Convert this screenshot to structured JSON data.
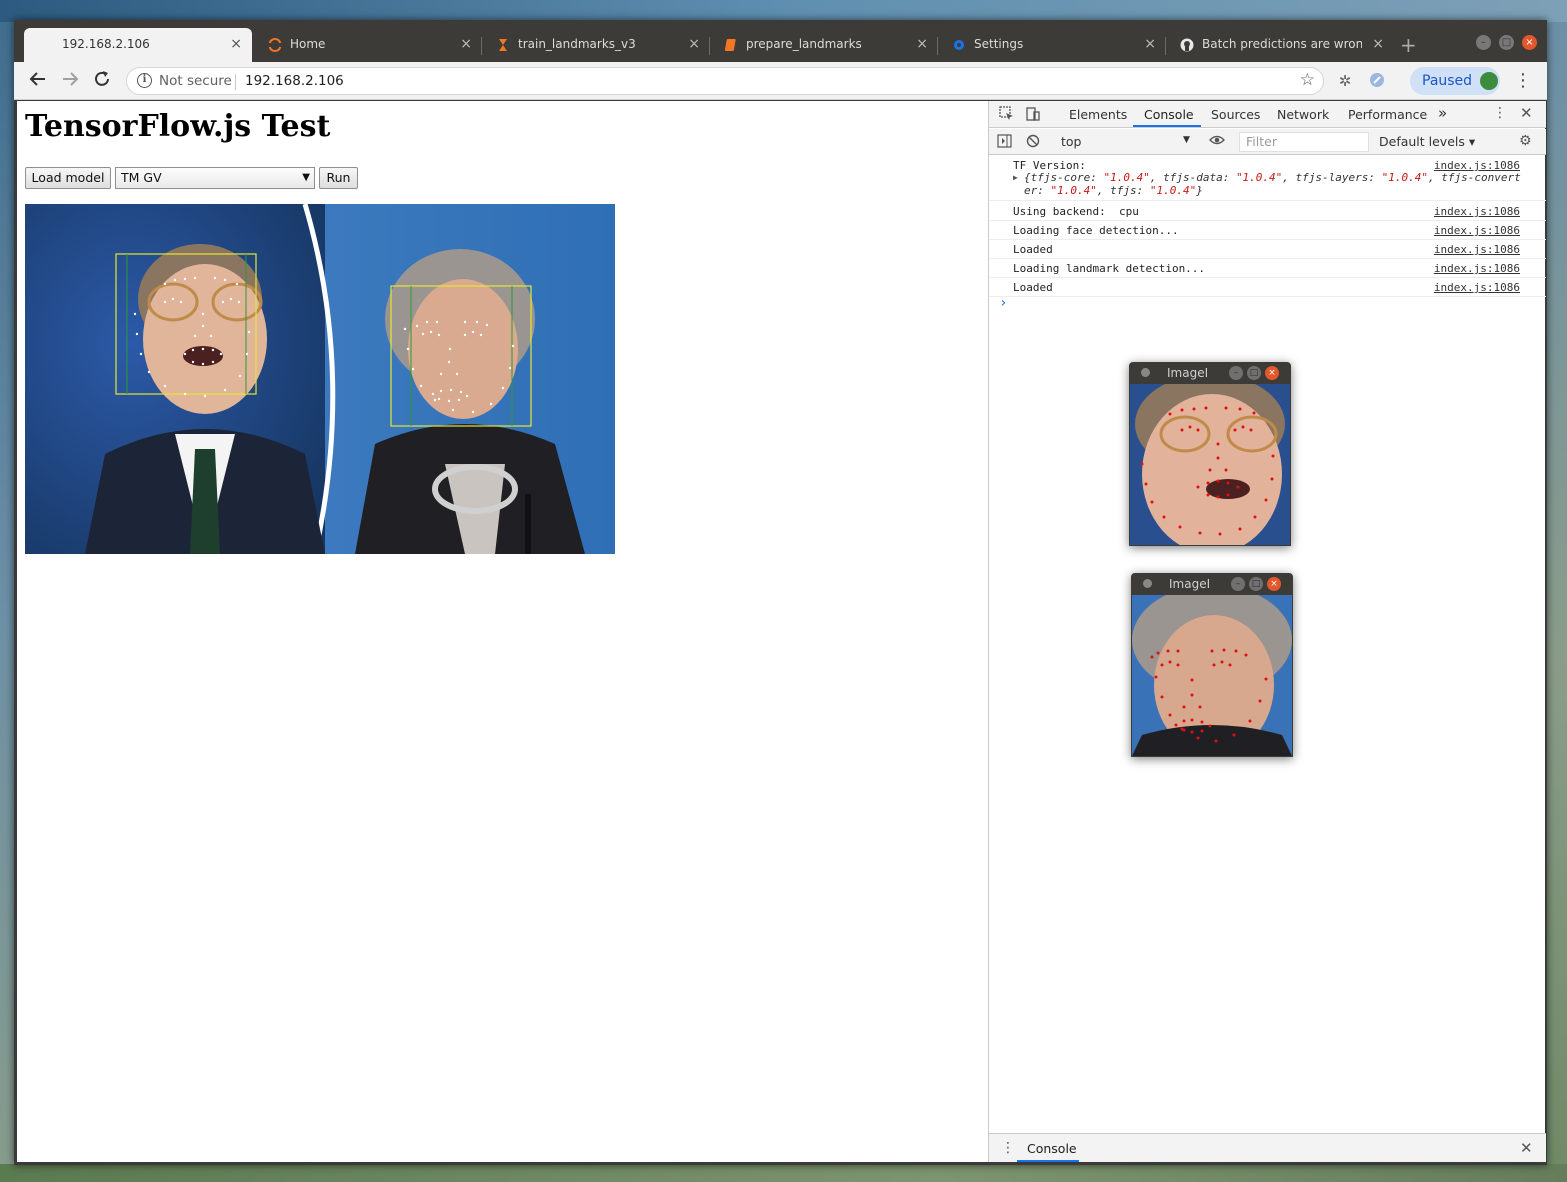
{
  "browser": {
    "tabs": [
      {
        "title": "192.168.2.106",
        "icon": "none",
        "active": true
      },
      {
        "title": "Home",
        "icon": "jupyter-icon"
      },
      {
        "title": "train_landmarks_v3",
        "icon": "hourglass-icon"
      },
      {
        "title": "prepare_landmarks",
        "icon": "notebook-icon"
      },
      {
        "title": "Settings",
        "icon": "gear-icon"
      },
      {
        "title": "Batch predictions are wrong",
        "icon": "github-icon"
      }
    ],
    "close_glyph": "×",
    "new_tab_glyph": "+",
    "omnibox": {
      "security_text": "Not secure",
      "url": "192.168.2.106"
    },
    "profile_status": "Paused"
  },
  "page": {
    "title": "TensorFlow.js Test",
    "load_button": "Load model",
    "model_select": {
      "selected": "TM GV"
    },
    "run_button": "Run"
  },
  "devtools": {
    "tabs": [
      "Elements",
      "Console",
      "Sources",
      "Network",
      "Performance"
    ],
    "active_tab": "Console",
    "more_tabs_glyph": "»",
    "context": "top",
    "filter_placeholder": "Filter",
    "levels": "Default levels ▾",
    "console": [
      {
        "message": "TF Version:",
        "source": "index.js:1086"
      },
      {
        "message": "Using backend:  cpu",
        "source": "index.js:1086"
      },
      {
        "message": "Loading face detection...",
        "source": "index.js:1086"
      },
      {
        "message": "Loaded",
        "source": "index.js:1086"
      },
      {
        "message": "Loading landmark detection...",
        "source": "index.js:1086"
      },
      {
        "message": "Loaded",
        "source": "index.js:1086"
      }
    ],
    "tf_version_object": {
      "line1_prefix": "{tfjs-core: ",
      "core": "\"1.0.4\"",
      "data_key": ", tfjs-data: ",
      "data": "\"1.0.4\"",
      "layers_key": ", tfjs-layers: ",
      "layers": "\"1.0.4\"",
      "convert_key": ", tfjs-convert",
      "line2_prefix": "er: ",
      "converter": "\"1.0.4\"",
      "tfjs_key": ", tfjs: ",
      "tfjs": "\"1.0.4\"",
      "close": "}"
    },
    "prompt_glyph": "›",
    "drawer_tab": "Console"
  },
  "image_windows": [
    {
      "title": "ImageM"
    },
    {
      "title": "ImageM"
    }
  ],
  "colors": {
    "accent": "#1a73e8",
    "string_literal": "#c41a16",
    "bbox_yellow": "#e6e633",
    "bbox_green": "#2e9a2e",
    "landmark_red": "#e01010"
  }
}
